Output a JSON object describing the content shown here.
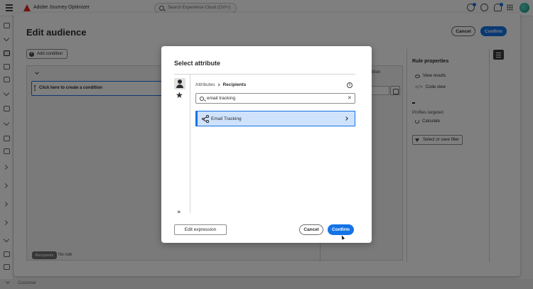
{
  "topbar": {
    "app_name": "Adobe Journey Optimizer",
    "search_placeholder": "Search Experience Cloud (Ctrl+/)",
    "icons": [
      "hamburger-icon",
      "adobe-logo",
      "search-icon",
      "feedback-icon",
      "help-icon",
      "bell-icon",
      "apps-grid-icon",
      "avatar"
    ]
  },
  "bottom_bar": {
    "label": "Customer"
  },
  "edit_audience": {
    "title": "Edit audience",
    "cancel_label": "Cancel",
    "confirm_label": "Confirm",
    "add_condition_label": "Add condition",
    "condition_placeholder": "Click here to create a condition",
    "partial_label": "dition",
    "recipients_tag": "Recipients",
    "no_rule": "No rule",
    "rule_properties": {
      "title": "Rule properties",
      "view_results": "View results",
      "code_view": "Code view",
      "count_value": "-",
      "profiles_targeted": "Profiles targeted",
      "calculate": "Calculate",
      "filter_button": "Select or save filter"
    }
  },
  "modal": {
    "title": "Select attribute",
    "breadcrumb": [
      "Attributes",
      "Recipients"
    ],
    "search_value": "email tracking",
    "results": [
      {
        "label": "Email Tracking"
      }
    ],
    "edit_expression_label": "Edit expression",
    "cancel_label": "Cancel",
    "confirm_label": "Confirm"
  },
  "colors": {
    "accent": "#1473e6",
    "selected_row": "#cfe2fb",
    "brand": "#e1251b",
    "overlay": "rgba(0,0,0,0.5)"
  }
}
